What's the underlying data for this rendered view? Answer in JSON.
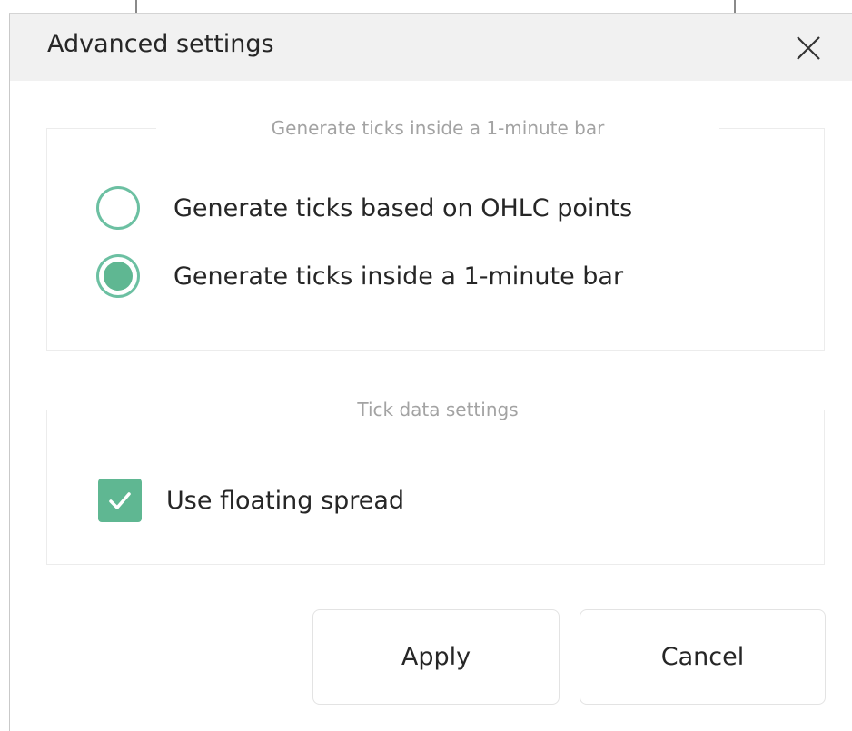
{
  "dialog": {
    "title": "Advanced settings",
    "close_icon": "close-icon"
  },
  "tick_generation": {
    "caption": "Generate ticks inside a 1-minute bar",
    "options": [
      {
        "label": "Generate ticks based on OHLC points",
        "selected": false
      },
      {
        "label": "Generate ticks inside a 1-minute bar",
        "selected": true
      }
    ]
  },
  "tick_data": {
    "caption": "Tick data settings",
    "floating_spread": {
      "label": "Use floating spread",
      "checked": true
    }
  },
  "buttons": {
    "apply": "Apply",
    "cancel": "Cancel"
  },
  "colors": {
    "accent": "#5fb792",
    "title_bar": "#f1f1f1",
    "caption_text": "#a3a3a3"
  }
}
